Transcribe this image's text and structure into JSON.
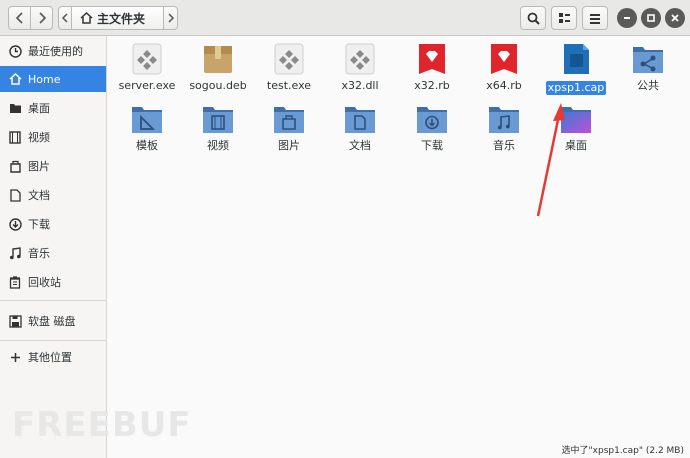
{
  "header": {
    "home_label": "主文件夹"
  },
  "sidebar": {
    "items": [
      {
        "label": "最近使用的",
        "icon": "clock-icon"
      },
      {
        "label": "Home",
        "icon": "home-icon"
      },
      {
        "label": "桌面",
        "icon": "desktop-folder-icon"
      },
      {
        "label": "视频",
        "icon": "video-icon"
      },
      {
        "label": "图片",
        "icon": "image-icon"
      },
      {
        "label": "文档",
        "icon": "document-icon"
      },
      {
        "label": "下载",
        "icon": "download-icon"
      },
      {
        "label": "音乐",
        "icon": "music-icon"
      },
      {
        "label": "回收站",
        "icon": "trash-icon"
      },
      {
        "label": "软盘 磁盘",
        "icon": "floppy-icon"
      },
      {
        "label": "其他位置",
        "icon": "plus-icon"
      }
    ]
  },
  "files": [
    {
      "name": "server.exe",
      "type": "exe"
    },
    {
      "name": "sogou.deb",
      "type": "deb"
    },
    {
      "name": "test.exe",
      "type": "exe"
    },
    {
      "name": "x32.dll",
      "type": "exe"
    },
    {
      "name": "x32.rb",
      "type": "rb"
    },
    {
      "name": "x64.rb",
      "type": "rb"
    },
    {
      "name": "xpsp1.cap",
      "type": "cap",
      "selected": true
    },
    {
      "name": "公共",
      "type": "folder-share"
    },
    {
      "name": "模板",
      "type": "folder-template"
    },
    {
      "name": "视频",
      "type": "folder-video"
    },
    {
      "name": "图片",
      "type": "folder-image"
    },
    {
      "name": "文档",
      "type": "folder-doc"
    },
    {
      "name": "下载",
      "type": "folder-download"
    },
    {
      "name": "音乐",
      "type": "folder-music"
    },
    {
      "name": "桌面",
      "type": "folder-desktop"
    }
  ],
  "status_text": "选中了\"xpsp1.cap\" (2.2 MB)",
  "watermark": "FREEBUF",
  "colors": {
    "accent": "#3584e4",
    "folder": "#5b8fc7",
    "ruby": "#e0242b"
  }
}
